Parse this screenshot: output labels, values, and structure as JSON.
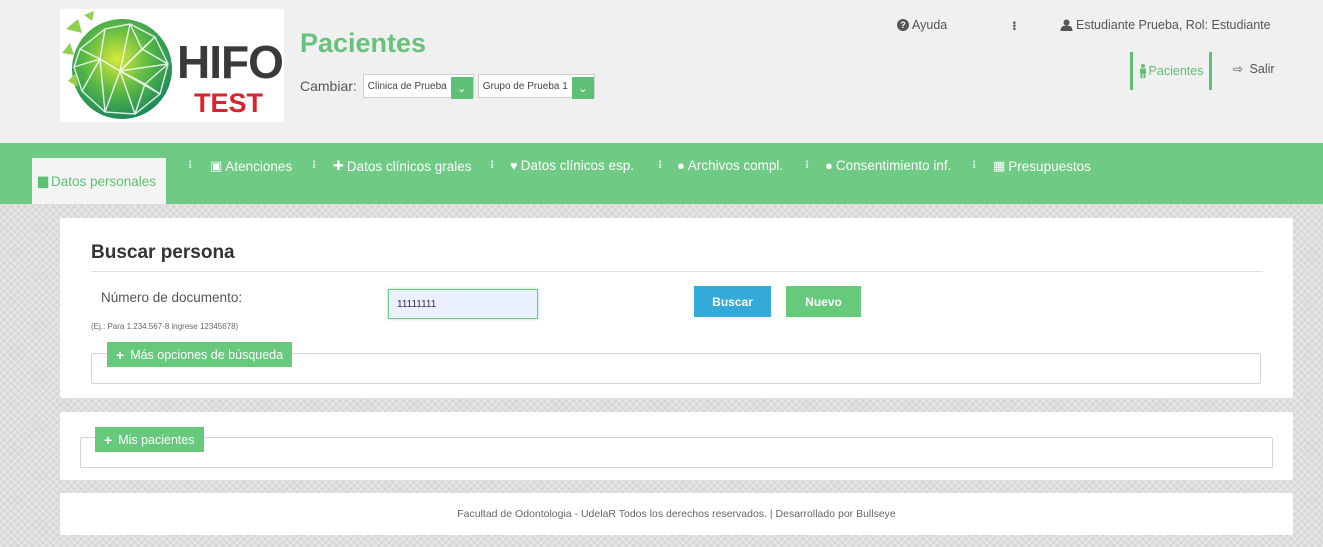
{
  "header": {
    "logo_main": "HIFO",
    "logo_sub": "TEST",
    "page_title": "Pacientes",
    "cambiar_label": "Cambiar:",
    "clinic_select": "Clinica de Prueba",
    "group_select": "Grupo de Prueba 1",
    "help_label": "Ayuda",
    "menu_dots": "⁝",
    "user_label": "Estudiante Prueba, Rol: Estudiante",
    "pacientes_link": "Pacientes",
    "salir_label": "Salir"
  },
  "nav": {
    "separator": "⁝",
    "items": [
      {
        "label": "Datos personales",
        "icon": "copy-icon",
        "active": true
      },
      {
        "label": "Atenciones",
        "icon": "ambulance-icon"
      },
      {
        "label": "Datos clínicos grales",
        "icon": "medkit-icon"
      },
      {
        "label": "Datos clínicos esp.",
        "icon": "heartbeat-icon"
      },
      {
        "label": "Archivos compl.",
        "icon": "user-md-icon"
      },
      {
        "label": "Consentimiento inf.",
        "icon": "user-md-icon"
      },
      {
        "label": "Presupuestos",
        "icon": "calculator-icon"
      }
    ]
  },
  "search": {
    "title": "Buscar persona",
    "doc_label": "Número de documento:",
    "doc_hint": "(Ej.: Para 1.234.567-8 ingrese 12345678)",
    "doc_value": "11111111",
    "buscar_label": "Buscar",
    "nuevo_label": "Nuevo",
    "more_options_label": "Más opciones de búsqueda"
  },
  "mis_pacientes": {
    "label": "Mis pacientes"
  },
  "footer": {
    "text": "Facultad de Odontologia - UdelaR Todos los derechos reservados. | Desarrollado por Bullseye"
  },
  "colors": {
    "brand_green": "#6fca84",
    "button_blue": "#33aad8",
    "logo_red": "#d9232d"
  }
}
